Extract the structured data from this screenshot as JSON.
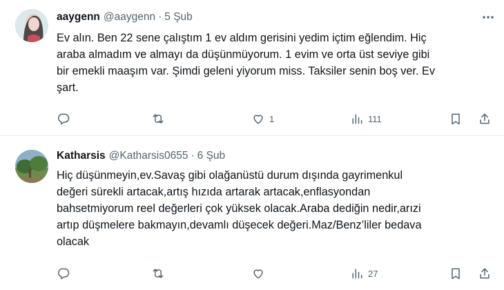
{
  "tweets": [
    {
      "name": "aaygenn",
      "handle": "@aaygenn",
      "separator": "·",
      "date": "5 Şub",
      "text": "Ev alın. Ben 22 sene çalıştım 1 ev aldım gerisini yedim içtim eğlendim. Hiç\naraba almadım ve almayı da düşünmüyorum. 1 evim ve orta üst seviye gibi\nbir emekli maaşım var. Şimdi geleni yiyorum miss. Taksiler senin boş ver. Ev\nşart.",
      "counts": {
        "reply": "",
        "retweet": "",
        "like": "1",
        "views": "111"
      }
    },
    {
      "name": "Katharsis",
      "handle": "@Katharsis0655",
      "separator": "·",
      "date": "6 Şub",
      "text": "Hiç düşünmeyin,ev.Savaş gibi olağanüstü durum dışında gayrimenkul\ndeğeri sürekli artacak,artış hızıda artarak artacak,enflasyondan\nbahsetmiyorum reel değerleri çok yüksek olacak.Araba dediğin nedir,arızi\nartıp düşmelere bakmayın,devamlı düşecek değeri.Maz/Benz’liler bedava\nolacak",
      "counts": {
        "reply": "",
        "retweet": "",
        "like": "",
        "views": "27"
      }
    }
  ],
  "icons": [
    "more-icon",
    "reply-icon",
    "retweet-icon",
    "like-icon",
    "views-icon",
    "bookmark-icon",
    "share-icon"
  ],
  "colors": {
    "text": "#0f1419",
    "secondary": "#536471",
    "divider": "#e6ebee",
    "background": "#ffffff"
  }
}
